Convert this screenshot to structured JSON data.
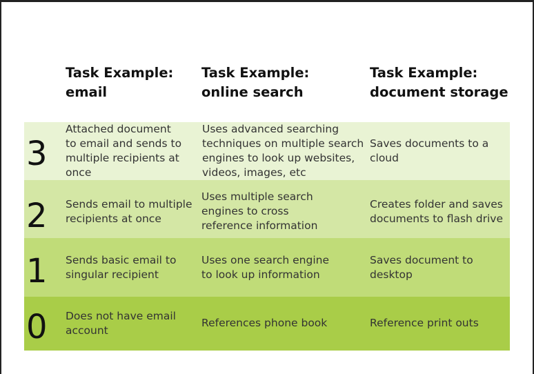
{
  "headers": [
    "Task Example:\nemail",
    "Task Example:\nonline search",
    "Task Example:\ndocument storage"
  ],
  "rows": [
    {
      "level": "3",
      "color": "#e9f3d4",
      "cells": [
        "Attached document\nto email and sends to\nmultiple recipients at\nonce",
        "Uses advanced searching\ntechniques on multiple search\nengines to look up websites,\nvideos, images, etc",
        "Saves documents to a\ncloud"
      ]
    },
    {
      "level": "2",
      "color": "#d4e7a5",
      "cells": [
        "Sends email to multiple\nrecipients at once",
        "Uses multiple search\nengines to cross\nreference information",
        "Creates folder and saves\ndocuments to flash drive"
      ]
    },
    {
      "level": "1",
      "color": "#c0dc78",
      "cells": [
        "Sends basic email to\nsingular recipient",
        "Uses one search engine\nto look up information",
        "Saves document to\ndesktop"
      ]
    },
    {
      "level": "0",
      "color": "#a9cd48",
      "cells": [
        "Does not have email\naccount",
        "References phone book",
        "Reference print outs"
      ]
    }
  ]
}
